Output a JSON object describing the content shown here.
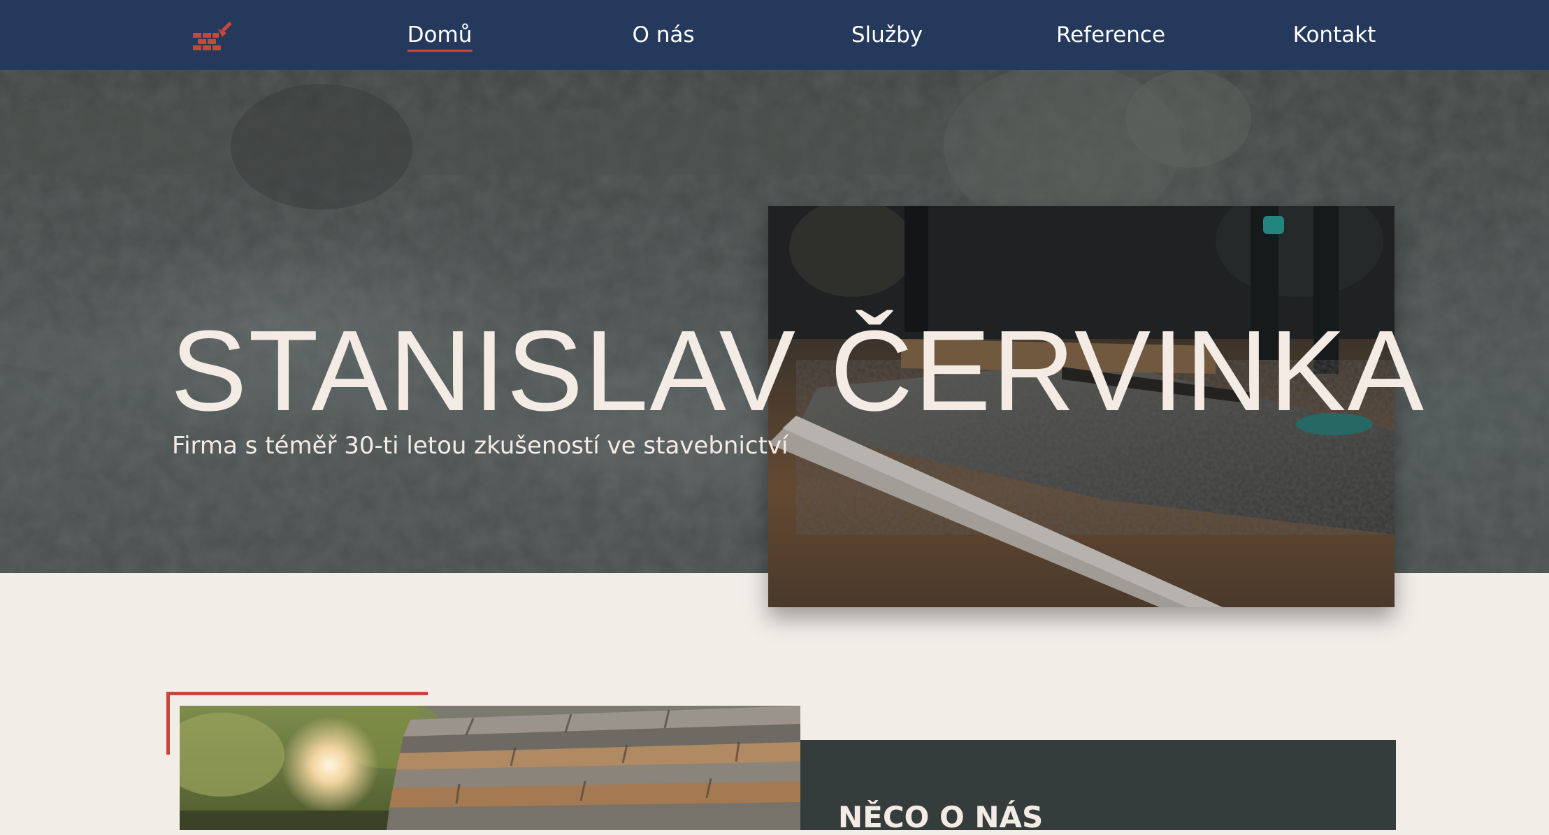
{
  "nav": {
    "logo_icon": "brick-wall-trowel-icon",
    "items": [
      {
        "label": "Domů",
        "active": true
      },
      {
        "label": "O nás",
        "active": false
      },
      {
        "label": "Služby",
        "active": false
      },
      {
        "label": "Reference",
        "active": false
      },
      {
        "label": "Kontakt",
        "active": false
      }
    ]
  },
  "hero": {
    "title": "STANISLAV ČERVINKA",
    "subtitle": "Firma s téměř 30-ti letou zkušeností ve stavebnictví"
  },
  "about": {
    "heading": "NĚCO O NÁS"
  },
  "colors": {
    "navbar": "#25395c",
    "accent": "#c9473a",
    "page_background": "#f3ede8",
    "panel": "#343c3c",
    "hero_text": "#f4ebe4"
  }
}
